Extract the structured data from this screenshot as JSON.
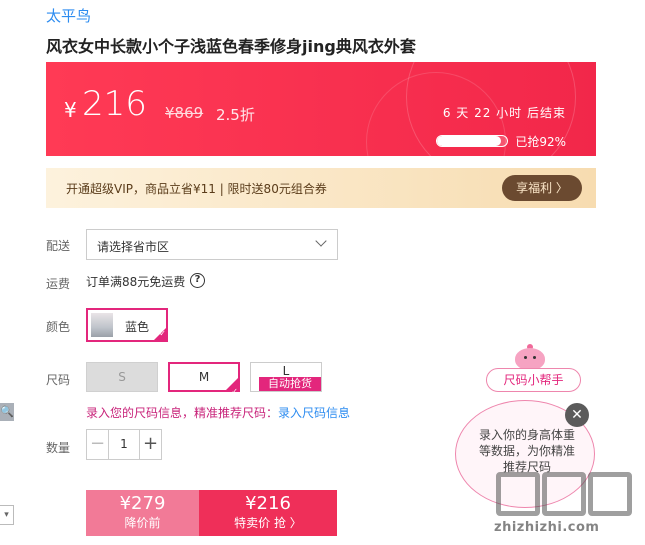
{
  "brand": "太平鸟",
  "product_title": "风衣女中长款小个子浅蓝色春季修身jing典风衣外套",
  "price_banner": {
    "currency": "¥",
    "price": "216",
    "original_price": "¥869",
    "discount": "2.5折",
    "countdown": "6 天 22 小时 后结束",
    "sold_text": "已抢92%",
    "sold_fraction": 0.92
  },
  "vip": {
    "text": "开通超级VIP，商品立省¥11 | 限时送80元组合券",
    "button": "享福利 〉"
  },
  "delivery": {
    "label": "配送",
    "placeholder": "请选择省市区"
  },
  "shipping": {
    "label": "运费",
    "text": "订单满88元免运费",
    "icon": "question-icon"
  },
  "color": {
    "label": "颜色",
    "option": "蓝色"
  },
  "size": {
    "label": "尺码",
    "options": [
      "S",
      "M",
      "L"
    ],
    "selected": "M",
    "l_badge": "自动抢货",
    "tip_text": "录入您的尺码信息，精准推荐尺码：",
    "tip_link": "录入尺码信息"
  },
  "quantity": {
    "label": "数量",
    "value": "1",
    "minus": "−",
    "plus": "+"
  },
  "buttons": {
    "orig_price": "¥279",
    "orig_label": "降价前",
    "sale_price": "¥216",
    "sale_label": "特卖价 抢 〉"
  },
  "helper": {
    "button": "尺码小帮手",
    "bubble_text": "录入你的身高体重等数据，为你精准推荐尺码",
    "close": "✕"
  },
  "watermark": {
    "url": "zhizhizhi.com"
  },
  "colors": {
    "accent": "#e3267c",
    "banner": "#f2274a",
    "link": "#2d8cf0"
  }
}
